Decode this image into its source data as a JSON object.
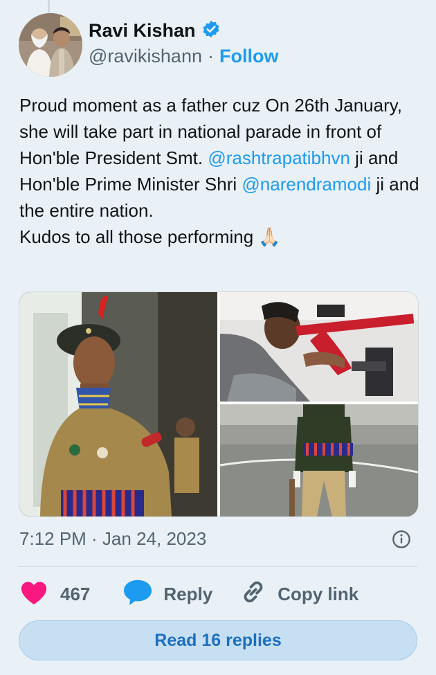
{
  "author": {
    "display_name": "Ravi Kishan",
    "handle": "@ravikishann",
    "separator": "·",
    "follow_label": "Follow"
  },
  "tweet": {
    "lines": [
      {
        "parts": [
          {
            "text": "Proud moment as a father cuz On 26th January, she will take part in national parade in front of Hon'ble President Smt. "
          },
          {
            "text": "@rashtrapatibhvn",
            "mention": true
          },
          {
            "text": " ji and Hon'ble Prime Minister Shri "
          },
          {
            "text": "@narendramodi",
            "mention": true
          },
          {
            "text": " ji and the entire nation."
          }
        ]
      },
      {
        "parts": [
          {
            "text": "Kudos to all those performing 🙏🏻"
          }
        ]
      }
    ]
  },
  "timestamp": "7:12 PM · Jan 24, 2023",
  "actions": {
    "likes": "467",
    "reply_label": "Reply",
    "copy_link_label": "Copy link"
  },
  "read_replies_label": "Read 16 replies",
  "colors": {
    "accent": "#1d9bf0",
    "like": "#f91880",
    "verified": "#1d9bf0"
  }
}
